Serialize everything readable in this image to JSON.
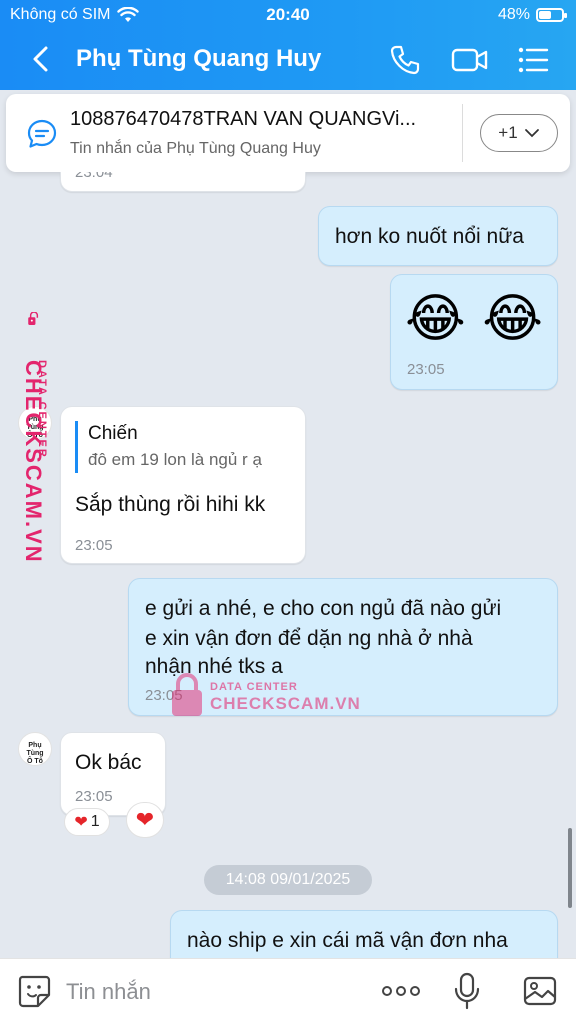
{
  "status_bar": {
    "carrier": "Không có SIM",
    "time": "20:40",
    "battery": "48%",
    "battery_level": 0.48
  },
  "header": {
    "title": "Phụ Tùng Quang Huy",
    "accent_color": "#1a8cf5"
  },
  "pinned": {
    "title": "108876470478TRAN VAN QUANGVi...",
    "subtitle": "Tin nhắn của Phụ Tùng Quang Huy",
    "more_label": "+1"
  },
  "partial_time": "23:04",
  "messages": {
    "m1": {
      "text": "hơn ko nuốt nổi nữa"
    },
    "m2": {
      "emoji": "😂 😂",
      "time": "23:05"
    },
    "m3": {
      "reply_name": "Chiến",
      "reply_text": "đô em 19 lon là ngủ r ạ",
      "text": "Sắp thùng rồi hihi kk",
      "time": "23:05"
    },
    "m4": {
      "line1": "e gửi a nhé, e cho con ngủ đã nào gửi",
      "line2": "e xin vận đơn để dặn ng nhà ở nhà",
      "line3": "nhận nhé tks a",
      "time": "23:05"
    },
    "m5": {
      "text": "Ok bác",
      "time": "23:05",
      "reaction_count": "1"
    },
    "m6": {
      "text": "nào ship e xin cái mã vận đơn nha"
    }
  },
  "avatar": {
    "line1": "Phụ Tùng",
    "line2": "Ô Tô"
  },
  "date_separator": "14:08 09/01/2025",
  "watermark": {
    "small": "DATA CENTER",
    "big": "CHECKSCAM.VN",
    "color": "#e3256d"
  },
  "input": {
    "placeholder": "Tin nhắn"
  }
}
